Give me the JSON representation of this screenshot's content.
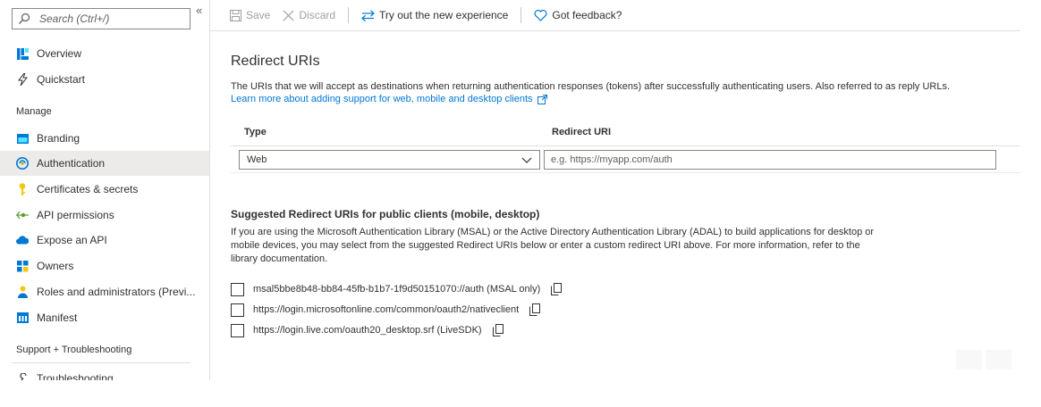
{
  "sidebar": {
    "search_placeholder": "Search (Ctrl+/)",
    "collapse_glyph": "«",
    "items_top": [
      {
        "label": "Overview",
        "icon": "overview-grid-icon"
      },
      {
        "label": "Quickstart",
        "icon": "quickstart-bolt-icon"
      }
    ],
    "manage_label": "Manage",
    "items_manage": [
      {
        "label": "Branding",
        "icon": "branding-icon"
      },
      {
        "label": "Authentication",
        "icon": "authentication-icon",
        "selected": true
      },
      {
        "label": "Certificates & secrets",
        "icon": "key-icon"
      },
      {
        "label": "API permissions",
        "icon": "api-permissions-icon"
      },
      {
        "label": "Expose an API",
        "icon": "cloud-icon"
      },
      {
        "label": "Owners",
        "icon": "owners-icon"
      },
      {
        "label": "Roles and administrators (Previ...",
        "icon": "roles-icon"
      },
      {
        "label": "Manifest",
        "icon": "manifest-icon"
      }
    ],
    "support_label": "Support + Troubleshooting",
    "items_support": [
      {
        "label": "Troubleshooting",
        "icon": "wrench-icon"
      }
    ]
  },
  "toolbar": {
    "save_label": "Save",
    "discard_label": "Discard",
    "try_label": "Try out the new experience",
    "feedback_label": "Got feedback?"
  },
  "main": {
    "title": "Redirect URIs",
    "description": "The URIs that we will accept as destinations when returning authentication responses (tokens) after successfully authenticating users. Also referred to as reply URLs.",
    "learn_link": "Learn more about adding support for web, mobile and desktop clients",
    "grid": {
      "col_type": "Type",
      "col_uri": "Redirect URI",
      "type_value": "Web",
      "uri_placeholder": "e.g. https://myapp.com/auth"
    },
    "suggested": {
      "title": "Suggested Redirect URIs for public clients (mobile, desktop)",
      "description": "If you are using the Microsoft Authentication Library (MSAL) or the Active Directory Authentication Library (ADAL) to build applications for desktop or mobile devices, you may select from the suggested Redirect URIs below or enter a custom redirect URI above. For more information, refer to the library documentation.",
      "uris": [
        {
          "label": "msal5bbe8b48-bb84-45fb-b1b7-1f9d50151070://auth (MSAL only)",
          "checked": false
        },
        {
          "label": "https://login.microsoftonline.com/common/oauth2/nativeclient",
          "checked": false
        },
        {
          "label": "https://login.live.com/oauth20_desktop.srf (LiveSDK)",
          "checked": false
        }
      ]
    }
  },
  "colors": {
    "accent": "#0078d4",
    "selected_bg": "#edebe9",
    "border": "#8a8886"
  }
}
